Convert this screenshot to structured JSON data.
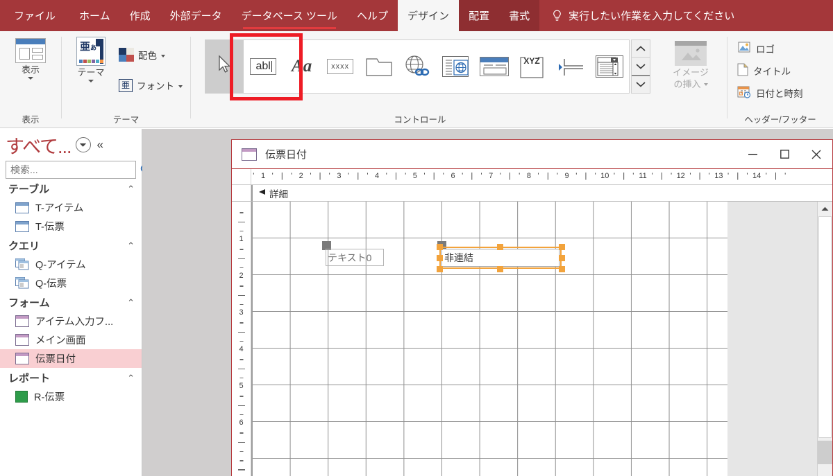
{
  "window": {
    "app": "Microsoft Access",
    "tabs": [
      {
        "label": "ファイル",
        "state": "file"
      },
      {
        "label": "ホーム",
        "state": "normal"
      },
      {
        "label": "作成",
        "state": "normal"
      },
      {
        "label": "外部データ",
        "state": "normal"
      },
      {
        "label": "データベース ツール",
        "state": "underlined"
      },
      {
        "label": "ヘルプ",
        "state": "normal"
      },
      {
        "label": "デザイン",
        "state": "active"
      },
      {
        "label": "配置",
        "state": "contextual"
      },
      {
        "label": "書式",
        "state": "contextual"
      }
    ],
    "tellme": "実行したい作業を入力してください",
    "tellme_icon": "lightbulb-icon",
    "accent": "#a4373a",
    "contextual_bg": "#8e2e31",
    "tab_underline": "#e23b3e"
  },
  "ribbon": {
    "groups": [
      {
        "label": "表示"
      },
      {
        "label": "テーマ"
      },
      {
        "label": "コントロール"
      },
      {
        "label": "ヘッダー/フッター"
      }
    ],
    "view_button": {
      "label": "表示",
      "icon": "view-switch-icon"
    },
    "theme_button": {
      "label": "テーマ",
      "icon": "theme-icon"
    },
    "colors_button": {
      "label": "配色",
      "icon": "color-palette-icon"
    },
    "fonts_button": {
      "label": "フォント",
      "icon": "theme-font-icon"
    },
    "controls": [
      {
        "name": "select-tool",
        "icon": "arrow-cursor-icon",
        "selected": true
      },
      {
        "name": "text-box",
        "icon": "abl-textbox-icon",
        "glyph": "abl",
        "highlighted": true
      },
      {
        "name": "label",
        "icon": "Aa-label-icon",
        "glyph": "Aa"
      },
      {
        "name": "button",
        "icon": "xxxx-button-icon",
        "glyph": "xxxx"
      },
      {
        "name": "tab-control",
        "icon": "folder-tab-icon"
      },
      {
        "name": "hyperlink",
        "icon": "globe-link-icon"
      },
      {
        "name": "web-browser-control",
        "icon": "web-browser-icon"
      },
      {
        "name": "navigation-control",
        "icon": "navigation-control-icon"
      },
      {
        "name": "unbound-object-frame",
        "icon": "xyz-frame-icon",
        "glyph": "XYZ"
      },
      {
        "name": "page-break",
        "icon": "page-break-icon"
      },
      {
        "name": "combo-box",
        "icon": "combo-box-icon"
      }
    ],
    "gallery_scroll": {
      "up": "▲",
      "down": "▼",
      "more": "▼"
    },
    "insert_image": {
      "label_line1": "イメージ",
      "label_line2": "の挿入",
      "icon": "insert-image-icon",
      "disabled": true
    },
    "header_footer": [
      {
        "label": "ロゴ",
        "icon": "logo-icon"
      },
      {
        "label": "タイトル",
        "icon": "title-icon"
      },
      {
        "label": "日付と時刻",
        "icon": "date-time-icon"
      }
    ]
  },
  "sidebar": {
    "title": "すべて...",
    "dropdown_icon": "chevron-circle-down-icon",
    "collapse_icon": "double-chevron-left-icon",
    "search": {
      "placeholder": "検索...",
      "value": "",
      "icon": "search-icon"
    },
    "groups": [
      {
        "label": "テーブル",
        "chevron": "⌃",
        "items": [
          {
            "label": "T-アイテム",
            "icon": "table-icon",
            "selected": false
          },
          {
            "label": "T-伝票",
            "icon": "table-icon",
            "selected": false
          }
        ]
      },
      {
        "label": "クエリ",
        "chevron": "⌃",
        "items": [
          {
            "label": "Q-アイテム",
            "icon": "query-icon",
            "selected": false
          },
          {
            "label": "Q-伝票",
            "icon": "query-icon",
            "selected": false
          }
        ]
      },
      {
        "label": "フォーム",
        "chevron": "⌃",
        "items": [
          {
            "label": "アイテム入力フ...",
            "icon": "form-icon",
            "selected": false
          },
          {
            "label": "メイン画面",
            "icon": "form-icon",
            "selected": false
          },
          {
            "label": "伝票日付",
            "icon": "form-icon",
            "selected": true
          }
        ]
      },
      {
        "label": "レポート",
        "chevron": "⌃",
        "items": [
          {
            "label": "R-伝票",
            "icon": "report-icon",
            "selected": false
          }
        ]
      }
    ],
    "selected_bg": "#f9cfd2"
  },
  "form_designer": {
    "title": "伝票日付",
    "title_icon": "form-icon",
    "window_controls": {
      "minimize": "—",
      "maximize": "□",
      "close": "✕"
    },
    "section_header": {
      "label": "詳細",
      "icon": "section-expander-icon"
    },
    "h_ruler_ticks": [
      "1",
      "2",
      "3",
      "4",
      "5",
      "6",
      "7",
      "8",
      "9",
      "10",
      "11",
      "12",
      "13",
      "14"
    ],
    "v_ruler_ticks": [
      "1",
      "2",
      "3",
      "4",
      "5",
      "6"
    ],
    "controls": [
      {
        "name": "label-control",
        "text": "テキスト0",
        "selected": false,
        "handle": "move-handle"
      },
      {
        "name": "textbox-control",
        "text": "非連結",
        "selected": true,
        "handle": "move-handle",
        "selection_color": "#f2a33c"
      }
    ],
    "scrollbar": {
      "up_arrow": "▲"
    }
  }
}
